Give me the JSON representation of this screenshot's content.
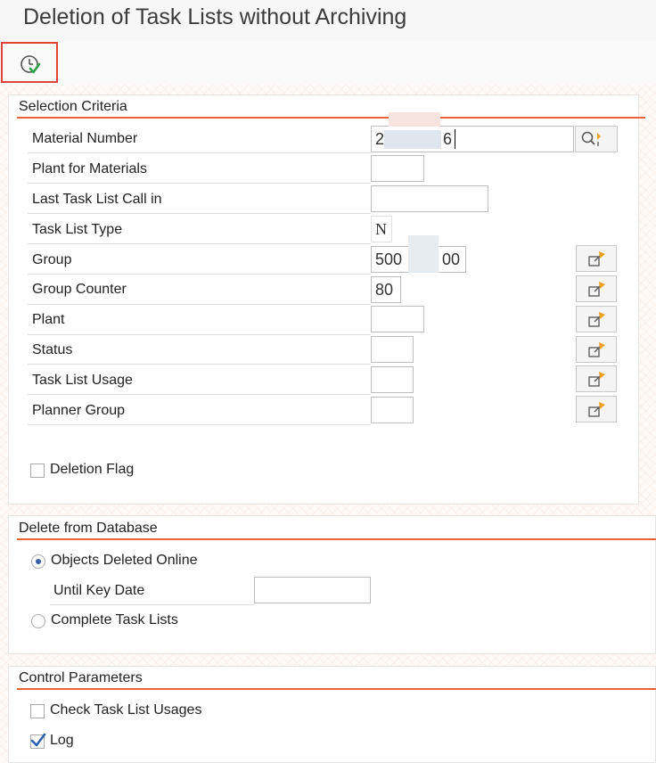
{
  "window": {
    "title": "Deletion of Task Lists without Archiving"
  },
  "toolbar": {
    "execute_icon": "execute-clock-check-icon"
  },
  "colors": {
    "accent_line": "#e8623a",
    "highlight_box": "#e0423c",
    "check_mark": "#2c63b0",
    "matchcode_arrow": "#f0a020"
  },
  "selection_criteria": {
    "title": "Selection Criteria",
    "material_number": {
      "label": "Material Number",
      "value_start": "2",
      "value_end": "6"
    },
    "plant_for_materials": {
      "label": "Plant for Materials",
      "value": ""
    },
    "last_task_list_call": {
      "label": "Last Task List Call in",
      "value": ""
    },
    "task_list_type": {
      "label": "Task List Type",
      "value": "N"
    },
    "group": {
      "label": "Group",
      "value_start": "500",
      "value_end": "00"
    },
    "group_counter": {
      "label": "Group Counter",
      "value": "80"
    },
    "plant": {
      "label": "Plant",
      "value": ""
    },
    "status": {
      "label": "Status",
      "value": ""
    },
    "task_list_usage": {
      "label": "Task List Usage",
      "value": ""
    },
    "planner_group": {
      "label": "Planner Group",
      "value": ""
    },
    "deletion_flag": {
      "label": "Deletion Flag",
      "checked": false
    }
  },
  "delete_from_database": {
    "title": "Delete from Database",
    "objects_deleted_online": {
      "label": "Objects Deleted Online",
      "selected": true
    },
    "until_key_date": {
      "label": "Until Key Date",
      "value": ""
    },
    "complete_task_lists": {
      "label": "Complete Task Lists",
      "selected": false
    }
  },
  "control_parameters": {
    "title": "Control Parameters",
    "check_task_list_usages": {
      "label": "Check Task List Usages",
      "checked": false
    },
    "log": {
      "label": "Log",
      "checked": true
    }
  }
}
